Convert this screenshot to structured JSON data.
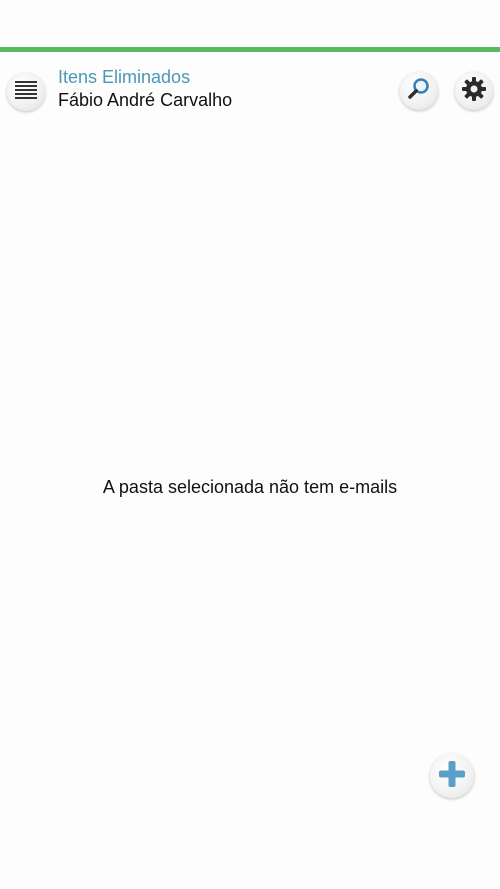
{
  "header": {
    "folder_title": "Itens Eliminados",
    "account_name": "Fábio André Carvalho",
    "icons": {
      "menu": "menu-icon",
      "search": "search-icon",
      "settings": "gear-icon"
    }
  },
  "main": {
    "empty_message": "A pasta selecionada não tem e-mails"
  },
  "fab": {
    "icon": "plus-icon"
  },
  "colors": {
    "accent_bar": "#5cb85c",
    "folder_title": "#4a97b8",
    "plus_icon": "#5b9fc9"
  }
}
